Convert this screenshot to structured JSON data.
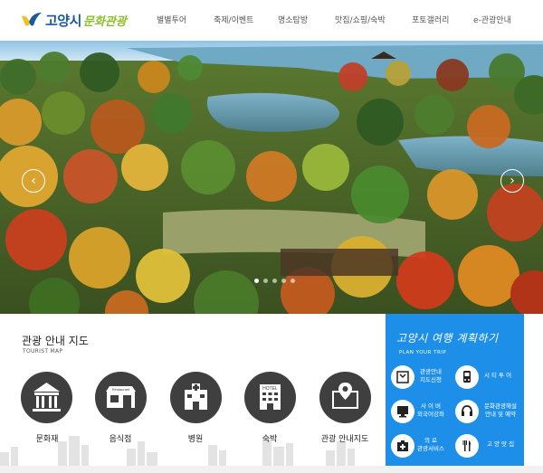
{
  "header": {
    "logo_text": "고양시",
    "logo_sub": "문화관광",
    "nav": [
      "별별투어",
      "축제/이벤트",
      "명소탐방",
      "맛집/쇼핑/숙박",
      "포토갤러리",
      "e-관광안내"
    ]
  },
  "hero": {
    "prev_icon": "‹",
    "next_icon": "›",
    "slides_count": 5,
    "active_slide": 1
  },
  "tourist_map": {
    "title": "관광 안내 지도",
    "subtitle": "TOURIST MAP",
    "items": [
      {
        "label": "문화재",
        "icon": "museum-icon"
      },
      {
        "label": "음식점",
        "icon": "restaurant-icon"
      },
      {
        "label": "병원",
        "icon": "hospital-icon"
      },
      {
        "label": "숙박",
        "icon": "hotel-icon"
      },
      {
        "label": "관광 안내지도",
        "icon": "map-icon"
      }
    ],
    "restaurant_sign": "Restaurant",
    "hotel_sign": "HOTEL"
  },
  "plan": {
    "title": "고양시 여행 계획하기",
    "subtitle": "PLAN YOUR TRIP",
    "items": [
      {
        "label_lines": [
          "관광안내",
          "지도신청"
        ],
        "icon": "map-book-icon"
      },
      {
        "label_lines": [
          "시 티 투 어"
        ],
        "icon": "bus-icon"
      },
      {
        "label_lines": [
          "사 이 버",
          "외국어강좌"
        ],
        "icon": "monitor-icon"
      },
      {
        "label_lines": [
          "문화관광해설",
          "안내 및 예약"
        ],
        "icon": "headset-icon"
      },
      {
        "label_lines": [
          "의 료",
          "관광서비스"
        ],
        "icon": "medical-kit-icon"
      },
      {
        "label_lines": [
          "고 양 맛 집"
        ],
        "icon": "fork-knife-icon"
      }
    ]
  }
}
